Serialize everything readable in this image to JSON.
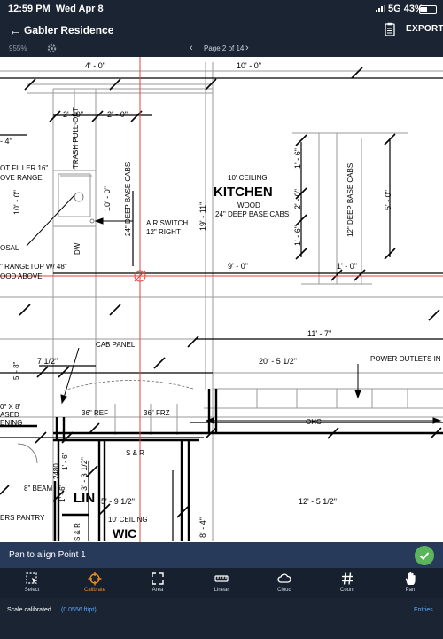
{
  "status": {
    "time": "12:59 PM",
    "date": "Wed Apr 8",
    "network": "5G 43%"
  },
  "header": {
    "back_icon": "arrow-left-icon",
    "title": "Gabler Residence",
    "export": "EXPORT"
  },
  "subbar": {
    "zoom": "955%",
    "page": "Page 2 of 14"
  },
  "plan": {
    "labels": {
      "dim_4_0": "4' - 0\"",
      "dim_10_0_top": "10' - 0\"",
      "dim_2_0_a": "2' - 0\"",
      "dim_2_0_b": "2' - 0\"",
      "dim_4_left": "- 4\"",
      "trash": "TRASH PULL-OUT",
      "filler_1": "OT FILLER 16\"",
      "filler_2": "OVE RANGE",
      "dim_10_0_left": "10' - 0\"",
      "dim_10_0_mid": "10' - 0\"",
      "deep_base_left": "24\" DEEP BASE CABS",
      "ceiling": "10' CEILING",
      "kitchen": "KITCHEN",
      "wood": "WOOD",
      "deep_base_main": "24\" DEEP BASE CABS",
      "dim_19_11": "19' - 11\"",
      "air_switch_1": "AIR SWITCH",
      "air_switch_2": "12\" RIGHT",
      "dw": "DW",
      "osal": "OSAL",
      "rangetop_1": "\" RANGETOP W/ 48\"",
      "rangetop_2": "OOD ABOVE",
      "dim_1_6_a": "1' - 6\"",
      "dim_2_0_v": "2' - 0\"",
      "dim_1_6_b": "1' - 6\"",
      "deep_base_right": "12\" DEEP BASE CABS",
      "dim_5_0": "5' - 0\"",
      "dim_9_0": "9' - 0\"",
      "dim_1_0": "1' - 0\"",
      "dim_11_7": "11' - 7\"",
      "dim_20_5": "20' - 5 1/2\"",
      "power_outlets": "POWER OUTLETS IN",
      "cab_panel": "CAB PANEL",
      "dim_7_half": "7 1/2\"",
      "dim_5_8": "5' - 8\"",
      "x8_1": "0\" X 8'",
      "x8_2": "ASED",
      "x8_3": "ENING",
      "ref": "36\" REF",
      "frz": "36\" FRZ",
      "ohc": "OHC",
      "sr": "S & R",
      "n2480": "2480",
      "dim_1_6_c": "1' - 6\"",
      "dim_3_half": "3' - 3 1/2\"",
      "dim_1_6_d": "1' - 6\"",
      "beam": "8\" BEAM",
      "lin": "LIN",
      "dim_5_9": "5' - 9 1/2\"",
      "dim_12_5": "12' - 5 1/2\"",
      "pantry": "ERS PANTRY",
      "ceiling_wic": "10' CEILING",
      "wic": "WIC",
      "sr2": "S & R",
      "dim_8_4": "8' - 4\""
    }
  },
  "prompt": {
    "text": "Pan to align Point 1",
    "icon": "check-icon"
  },
  "tools": [
    {
      "label": "Select",
      "icon": "select-icon"
    },
    {
      "label": "Calibrate",
      "icon": "crosshair-icon"
    },
    {
      "label": "Area",
      "icon": "area-icon"
    },
    {
      "label": "Linear",
      "icon": "ruler-icon"
    },
    {
      "label": "Cloud",
      "icon": "cloud-icon"
    },
    {
      "label": "Count",
      "icon": "hash-icon"
    },
    {
      "label": "Pan",
      "icon": "hand-icon"
    }
  ],
  "footer": {
    "status_label": "Scale calibrated",
    "scale": "(0.0556 ft/pt)",
    "entries": "Entries"
  },
  "colors": {
    "accent": "#f08a24",
    "link": "#5aa8ff",
    "prompt_bg": "#273a5a",
    "ok": "#5bb55a",
    "crosshair": "#e0463f"
  }
}
